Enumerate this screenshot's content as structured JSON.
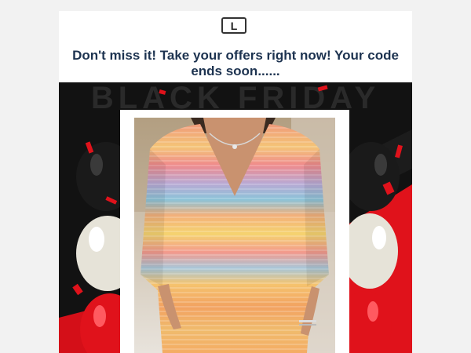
{
  "logo": {
    "letter": "L"
  },
  "headline": "Don't miss it! Take your offers right now! Your code ends soon......",
  "banner": {
    "watermark": "BLACK FRIDAY"
  },
  "colors": {
    "accent": "#e0121b",
    "headline": "#1d3350",
    "banner_bg": "#121212"
  },
  "icons": [
    "balloon-icon",
    "confetti-icon"
  ]
}
